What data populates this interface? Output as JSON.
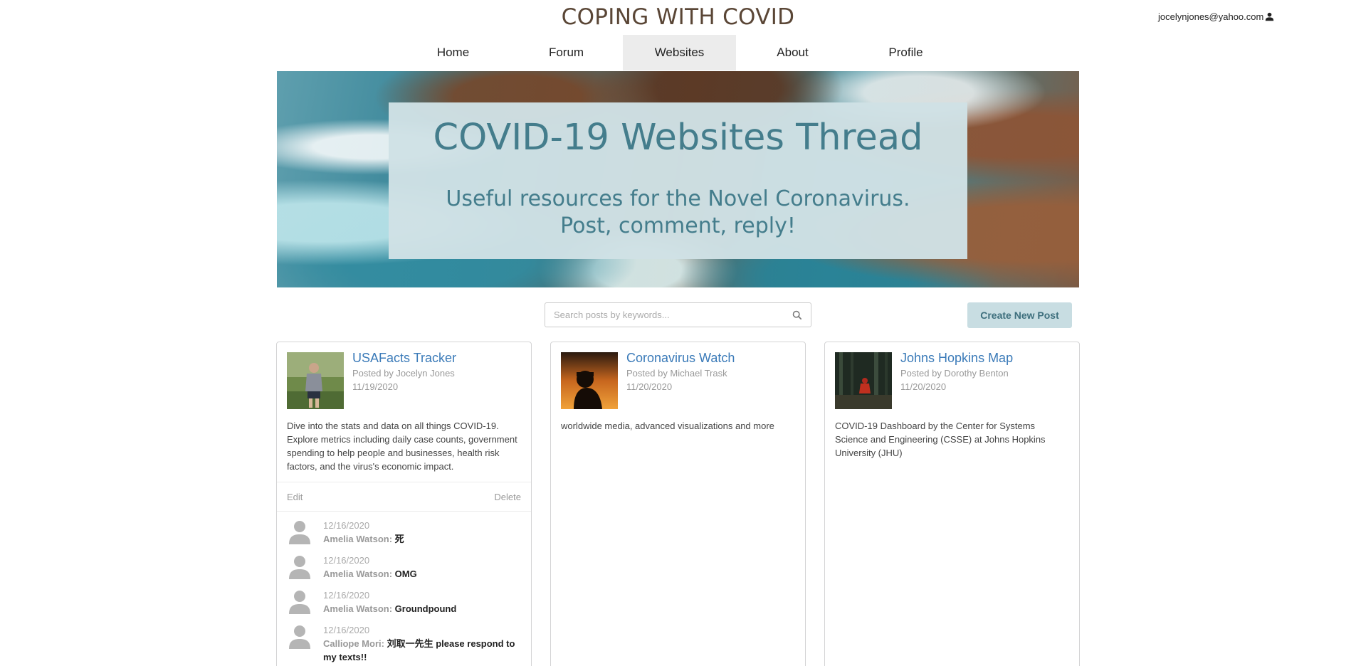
{
  "header": {
    "site_title": "COPING WITH COVID",
    "user_email": "jocelynjones@yahoo.com"
  },
  "nav": {
    "items": [
      {
        "label": "Home"
      },
      {
        "label": "Forum"
      },
      {
        "label": "Websites"
      },
      {
        "label": "About"
      },
      {
        "label": "Profile"
      }
    ],
    "active": "Websites"
  },
  "hero": {
    "title": "COVID-19 Websites Thread",
    "subtitle_line1": "Useful resources for the Novel Coronavirus.",
    "subtitle_line2": "Post, comment, reply!"
  },
  "search": {
    "placeholder": "Search posts by keywords...",
    "value": ""
  },
  "create_button": "Create New Post",
  "posts": [
    {
      "title": "USAFacts Tracker",
      "author": "Posted by Jocelyn Jones",
      "date": "11/19/2020",
      "description": "Dive into the stats and data on all things COVID-19. Explore metrics including daily case counts, government spending to help people and businesses, health risk factors, and the virus's economic impact.",
      "edit_label": "Edit",
      "delete_label": "Delete",
      "comments": [
        {
          "date": "12/16/2020",
          "author": "Amelia Watson:",
          "text": "死"
        },
        {
          "date": "12/16/2020",
          "author": "Amelia Watson:",
          "text": "OMG"
        },
        {
          "date": "12/16/2020",
          "author": "Amelia Watson:",
          "text": "Groundpound"
        },
        {
          "date": "12/16/2020",
          "author": "Calliope Mori:",
          "text": "刘取一先生 please respond to my texts!!"
        }
      ]
    },
    {
      "title": "Coronavirus Watch",
      "author": "Posted by Michael Trask",
      "date": "11/20/2020",
      "description": "worldwide media, advanced visualizations and more"
    },
    {
      "title": "Johns Hopkins Map",
      "author": "Posted by Dorothy Benton",
      "date": "11/20/2020",
      "description": "COVID-19 Dashboard by the Center for Systems Science and Engineering (CSSE) at Johns Hopkins University (JHU)"
    }
  ],
  "colors": {
    "title_brown": "#5a4636",
    "link_blue": "#3a7ab8",
    "hero_box": "#cfe1e5",
    "hero_text": "#447d8c",
    "button_bg": "#c8dde2"
  }
}
